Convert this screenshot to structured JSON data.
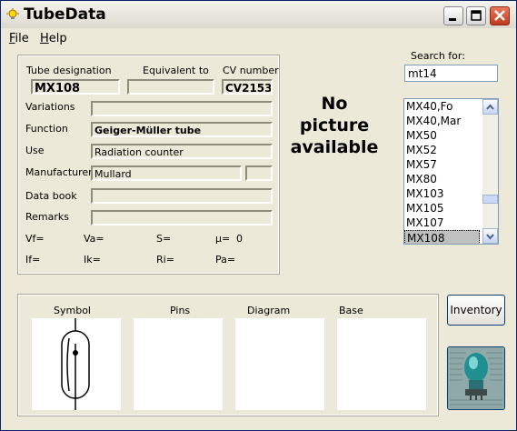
{
  "window": {
    "title": "TubeData"
  },
  "menu": {
    "file": "File",
    "help": "Help"
  },
  "fields": {
    "tube_designation": {
      "label": "Tube designation",
      "value": "MX108"
    },
    "equivalent_to": {
      "label": "Equivalent to",
      "value": ""
    },
    "cv_number": {
      "label": "CV number",
      "value": "CV2153"
    },
    "variations": {
      "label": "Variations",
      "value": ""
    },
    "function": {
      "label": "Function",
      "value": "Geiger-Müller tube"
    },
    "use": {
      "label": "Use",
      "value": "Radiation counter"
    },
    "manufacturer": {
      "label": "Manufacturer",
      "value": "Mullard",
      "extra": ""
    },
    "data_book": {
      "label": "Data book",
      "value": ""
    },
    "remarks": {
      "label": "Remarks",
      "value": ""
    }
  },
  "params": {
    "vf": "Vf=",
    "va": "Va=",
    "s": "S=",
    "mu": "µ=",
    "mu_value": "0",
    "if": "If=",
    "ik": "Ik=",
    "ri": "Ri=",
    "pa": "Pa="
  },
  "picture": {
    "line1": "No",
    "line2": "picture",
    "line3": "available"
  },
  "search": {
    "label": "Search for:",
    "value": "mt14"
  },
  "list": {
    "items": [
      "MX40,Fo",
      "MX40,Mar",
      "MX50",
      "MX52",
      "MX57",
      "MX80",
      "MX103",
      "MX105",
      "MX107",
      "MX108"
    ],
    "selected": "MX108"
  },
  "bottom": {
    "symbol": "Symbol",
    "pins": "Pins",
    "diagram": "Diagram",
    "base": "Base"
  },
  "buttons": {
    "inventory": "Inventory"
  }
}
